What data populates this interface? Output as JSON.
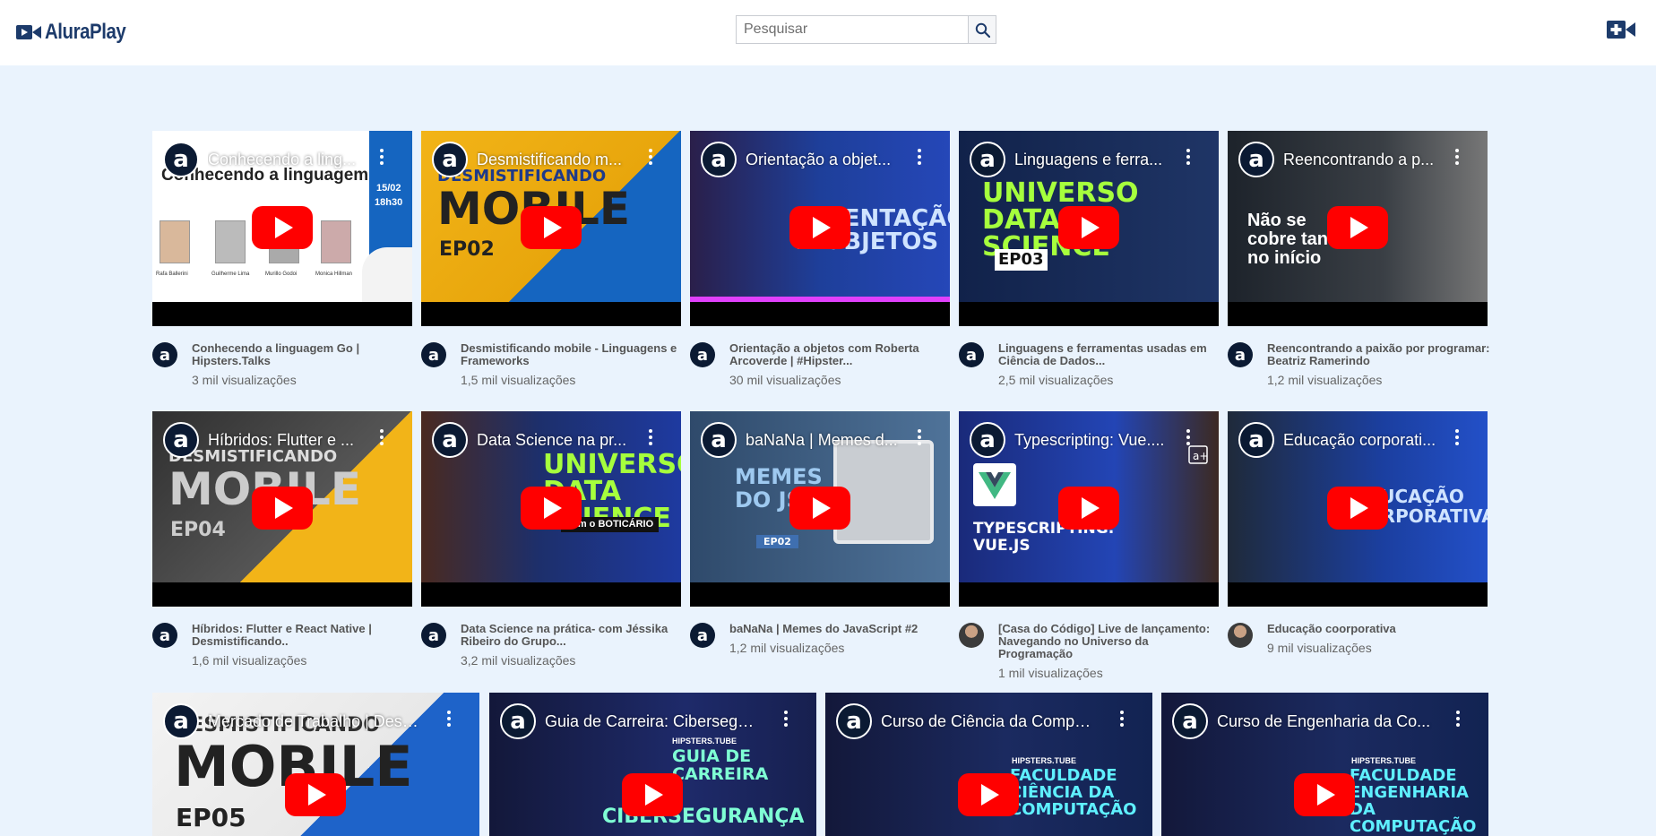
{
  "header": {
    "logo_text": "AluraPlay",
    "search_placeholder": "Pesquisar"
  },
  "row1": [
    {
      "overlay_title": "Conhecendo a ling...",
      "title": "Conhecendo a linguagem Go | Hipsters.Talks",
      "views": "3 mil visualizações",
      "thumb_text": "Conhecendo a linguagem Go",
      "thumb_badge_date": "15/02",
      "thumb_badge_time": "18h30",
      "people": [
        "Rafa Ballerini",
        "Guilherme Lima",
        "Murillo Godoi",
        "Monica Hillman"
      ]
    },
    {
      "overlay_title": "Desmistificando m...",
      "title": "Desmistificando mobile - Linguagens e Frameworks",
      "views": "1,5 mil visualizações",
      "thumb_text": "MOBILE",
      "thumb_sub": "EP02",
      "thumb_top": "DESMISTIFICANDO"
    },
    {
      "overlay_title": "Orientação a objet...",
      "title": "Orientação a objetos com Roberta Arcoverde | #Hipster...",
      "views": "30 mil visualizações",
      "thumb_text": "ORIENTAÇÃO A OBJETOS"
    },
    {
      "overlay_title": "Linguagens e ferra...",
      "title": "Linguagens e ferramentas usadas em Ciência de Dados...",
      "views": "2,5 mil visualizações",
      "thumb_text": "UNIVERSO DATA SCIENCE",
      "thumb_sub": "EP03"
    },
    {
      "overlay_title": "Reencontrando a p...",
      "title": "Reencontrando a paixão por programar: Beatriz Ramerindo",
      "views": "1,2 mil visualizações",
      "thumb_text": "Não se cobre tanto no início"
    }
  ],
  "row2": [
    {
      "overlay_title": "Híbridos: Flutter e ...",
      "title": "Híbridos: Flutter e React Native | Desmistificando..",
      "views": "1,6 mil visualizações",
      "thumb_text": "MOBILE",
      "thumb_sub": "EP04",
      "thumb_top": "DESMISTIFICANDO"
    },
    {
      "overlay_title": "Data Science na pr...",
      "title": "Data Science na prática- com Jéssika Ribeiro do Grupo...",
      "views": "3,2 mil visualizações",
      "thumb_text": "UNIVERSO DATA SCIENCE",
      "thumb_sub": "com o BOTICÁRIO"
    },
    {
      "overlay_title": "baNaNa | Memes d...",
      "title": "baNaNa | Memes do JavaScript #2",
      "views": "1,2 mil visualizações",
      "thumb_text": "MEMES DO JS",
      "thumb_sub": "EP02"
    },
    {
      "overlay_title": "Typescripting: Vue....",
      "title": "[Casa do Código] Live de lançamento: Navegando no Universo da Programação",
      "views": "1 mil visualizações",
      "thumb_text": "TYPESCRIPTING: VUE.JS"
    },
    {
      "overlay_title": "Educação corporati...",
      "title": "Educação coorporativa",
      "views": "9 mil visualizações",
      "thumb_text": "EDUCAÇÃO CORPORATIVA"
    }
  ],
  "row3": [
    {
      "overlay_title": "Mercado de Trabalho | Desm...",
      "thumb_text": "MOBILE",
      "thumb_sub": "EP05",
      "thumb_top": "DESMISTIFICANDO"
    },
    {
      "overlay_title": "Guia de Carreira: Cibersegur...",
      "thumb_text": "GUIA DE CARREIRA",
      "thumb_sub": "CIBERSEGURANÇA",
      "thumb_top": "HIPSTERS.TUBE"
    },
    {
      "overlay_title": "Curso de Ciência da Comput...",
      "thumb_text": "FACULDADE CIÊNCIA DA COMPUTAÇÃO",
      "thumb_top": "HIPSTERS.TUBE"
    },
    {
      "overlay_title": "Curso de Engenharia da Co...",
      "thumb_text": "FACULDADE ENGENHARIA DA COMPUTAÇÃO",
      "thumb_top": "HIPSTERS.TUBE"
    }
  ]
}
